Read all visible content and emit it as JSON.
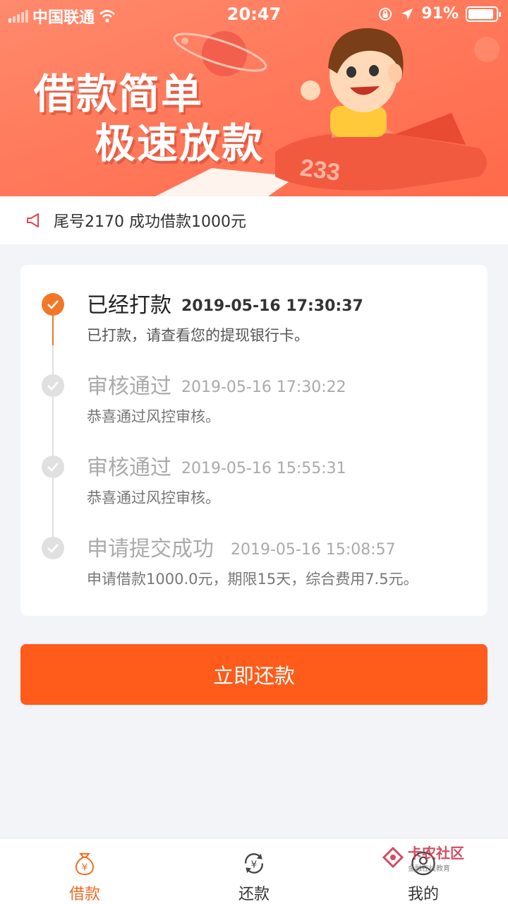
{
  "status_bar": {
    "carrier": "中国联通",
    "time": "20:47",
    "battery": "91%",
    "battery_level": 0.91
  },
  "banner": {
    "line1": "借款简单",
    "line2": "极速放款",
    "plane_number": "233"
  },
  "notice": {
    "text": "尾号2170 成功借款1000元"
  },
  "timeline": [
    {
      "title": "已经打款",
      "time": "2019-05-16 17:30:37",
      "desc": "已打款，请查看您的提现银行卡。",
      "state": "done"
    },
    {
      "title": "审核通过",
      "time": "2019-05-16 17:30:22",
      "desc": "恭喜通过风控审核。",
      "state": "past"
    },
    {
      "title": "审核通过",
      "time": "2019-05-16 15:55:31",
      "desc": "恭喜通过风控审核。",
      "state": "past"
    },
    {
      "title": "申请提交成功",
      "time": "2019-05-16 15:08:57",
      "desc": "申请借款1000.0元，期限15天，综合费用7.5元。",
      "state": "past"
    }
  ],
  "action": {
    "repay_label": "立即还款"
  },
  "tabs": [
    {
      "label": "借款",
      "icon": "money-bag-icon",
      "active": true
    },
    {
      "label": "还款",
      "icon": "yuan-refresh-icon",
      "active": false
    },
    {
      "label": "我的",
      "icon": "user-icon",
      "active": false
    }
  ],
  "watermark": {
    "title": "卡农社区",
    "subtitle": "金融在线教育"
  },
  "colors": {
    "accent": "#ff5b1a",
    "tab_active": "#f06a20",
    "banner": "#ff7a5c"
  }
}
